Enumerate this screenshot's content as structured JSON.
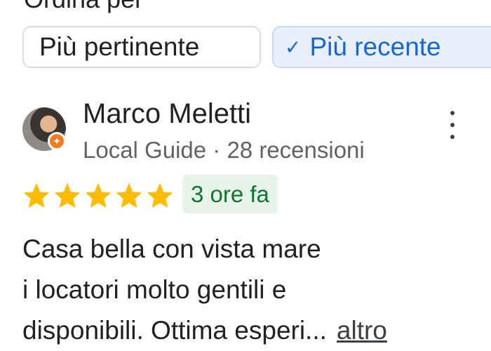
{
  "sort": {
    "heading": "Ordina per",
    "chips": [
      {
        "label": "Più pertinente",
        "selected": false
      },
      {
        "label": "Più recente",
        "selected": true
      }
    ],
    "selected_icon": "checkmark-icon"
  },
  "review": {
    "author": "Marco Meletti",
    "meta": "Local Guide · 28 recensioni",
    "rating": 5,
    "rating_max": 5,
    "time": "3 ore fa",
    "text_lines": [
      "Casa bella con vista mare",
      "i locatori molto gentili e",
      "disponibili. Ottima esperi..."
    ],
    "more_label": "altro",
    "menu_icon": "more-vert-icon",
    "badge_icon": "local-guide-badge-icon"
  },
  "colors": {
    "selected_chip_bg": "#e8f0fe",
    "selected_chip_text": "#1967d2",
    "star": "#fbbc04",
    "time_badge_bg": "#e6f4ea",
    "time_badge_text": "#137333",
    "local_guide_badge": "#f47b21"
  }
}
